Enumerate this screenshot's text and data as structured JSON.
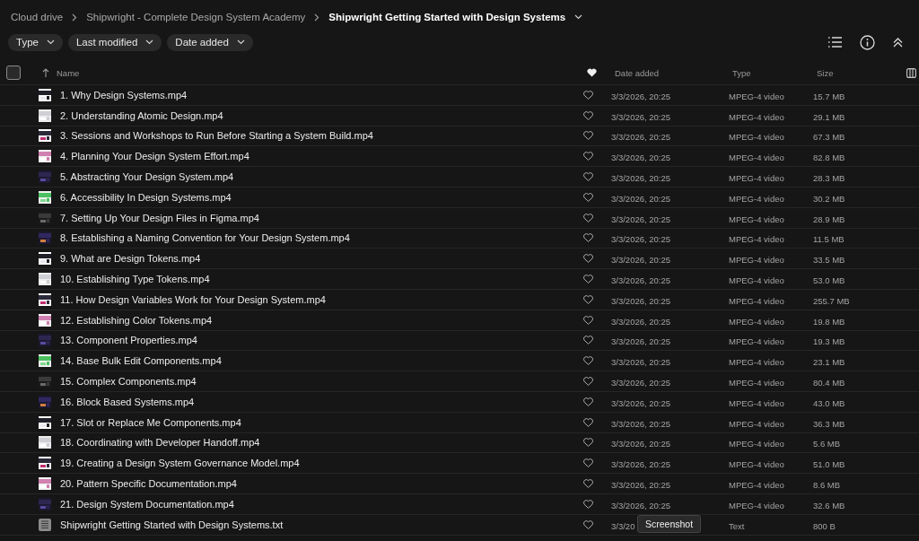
{
  "breadcrumbs": [
    {
      "label": "Cloud drive",
      "current": false
    },
    {
      "label": "Shipwright - Complete Design System Academy",
      "current": false
    },
    {
      "label": "Shipwright Getting Started with Design Systems",
      "current": true
    }
  ],
  "filters": [
    "Type",
    "Last modified",
    "Date added"
  ],
  "table": {
    "select_all": {
      "checked": false
    },
    "columns": [
      "Name",
      "Date added",
      "Type",
      "Size"
    ],
    "rows": [
      {
        "kind": "video",
        "name": "1. Why Design Systems.mp4",
        "favorite": false,
        "date": "3/3/2026, 20:25",
        "type": "MPEG-4 video",
        "size": "15.7 MB"
      },
      {
        "kind": "video",
        "name": "2. Understanding Atomic Design.mp4",
        "favorite": false,
        "date": "3/3/2026, 20:25",
        "type": "MPEG-4 video",
        "size": "29.1 MB"
      },
      {
        "kind": "video",
        "name": "3. Sessions and Workshops to Run Before Starting a System Build.mp4",
        "favorite": false,
        "date": "3/3/2026, 20:25",
        "type": "MPEG-4 video",
        "size": "67.3 MB"
      },
      {
        "kind": "video",
        "name": "4. Planning Your Design System Effort.mp4",
        "favorite": false,
        "date": "3/3/2026, 20:25",
        "type": "MPEG-4 video",
        "size": "82.8 MB"
      },
      {
        "kind": "video",
        "name": "5. Abstracting Your Design System.mp4",
        "favorite": false,
        "date": "3/3/2026, 20:25",
        "type": "MPEG-4 video",
        "size": "28.3 MB"
      },
      {
        "kind": "video",
        "name": "6. Accessibility In Design Systems.mp4",
        "favorite": false,
        "date": "3/3/2026, 20:25",
        "type": "MPEG-4 video",
        "size": "30.2 MB"
      },
      {
        "kind": "video",
        "name": "7. Setting Up Your Design Files in Figma.mp4",
        "favorite": false,
        "date": "3/3/2026, 20:25",
        "type": "MPEG-4 video",
        "size": "28.9 MB"
      },
      {
        "kind": "video",
        "name": "8. Establishing a Naming Convention for Your Design System.mp4",
        "favorite": false,
        "date": "3/3/2026, 20:25",
        "type": "MPEG-4 video",
        "size": "11.5 MB"
      },
      {
        "kind": "video",
        "name": "9. What are Design Tokens.mp4",
        "favorite": false,
        "date": "3/3/2026, 20:25",
        "type": "MPEG-4 video",
        "size": "33.5 MB"
      },
      {
        "kind": "video",
        "name": "10. Establishing Type Tokens.mp4",
        "favorite": false,
        "date": "3/3/2026, 20:25",
        "type": "MPEG-4 video",
        "size": "53.0 MB"
      },
      {
        "kind": "video",
        "name": "11. How Design Variables Work for Your Design System.mp4",
        "favorite": false,
        "date": "3/3/2026, 20:25",
        "type": "MPEG-4 video",
        "size": "255.7 MB"
      },
      {
        "kind": "video",
        "name": "12. Establishing Color Tokens.mp4",
        "favorite": false,
        "date": "3/3/2026, 20:25",
        "type": "MPEG-4 video",
        "size": "19.8 MB"
      },
      {
        "kind": "video",
        "name": "13. Component Properties.mp4",
        "favorite": false,
        "date": "3/3/2026, 20:25",
        "type": "MPEG-4 video",
        "size": "19.3 MB"
      },
      {
        "kind": "video",
        "name": "14. Base Bulk Edit Components.mp4",
        "favorite": false,
        "date": "3/3/2026, 20:25",
        "type": "MPEG-4 video",
        "size": "23.1 MB"
      },
      {
        "kind": "video",
        "name": "15. Complex Components.mp4",
        "favorite": false,
        "date": "3/3/2026, 20:25",
        "type": "MPEG-4 video",
        "size": "80.4 MB"
      },
      {
        "kind": "video",
        "name": "16. Block Based Systems.mp4",
        "favorite": false,
        "date": "3/3/2026, 20:25",
        "type": "MPEG-4 video",
        "size": "43.0 MB"
      },
      {
        "kind": "video",
        "name": "17. Slot or Replace Me Components.mp4",
        "favorite": false,
        "date": "3/3/2026, 20:25",
        "type": "MPEG-4 video",
        "size": "36.3 MB"
      },
      {
        "kind": "video",
        "name": "18. Coordinating with Developer Handoff.mp4",
        "favorite": false,
        "date": "3/3/2026, 20:25",
        "type": "MPEG-4 video",
        "size": "5.6 MB"
      },
      {
        "kind": "video",
        "name": "19. Creating a Design System Governance Model.mp4",
        "favorite": false,
        "date": "3/3/2026, 20:25",
        "type": "MPEG-4 video",
        "size": "51.0 MB"
      },
      {
        "kind": "video",
        "name": "20. Pattern Specific Documentation.mp4",
        "favorite": false,
        "date": "3/3/2026, 20:25",
        "type": "MPEG-4 video",
        "size": "8.6 MB"
      },
      {
        "kind": "video",
        "name": "21. Design System Documentation.mp4",
        "favorite": false,
        "date": "3/3/2026, 20:25",
        "type": "MPEG-4 video",
        "size": "32.6 MB"
      },
      {
        "kind": "text",
        "name": "Shipwright Getting Started with Design Systems.txt",
        "favorite": false,
        "date": "3/3/20",
        "type": "Text",
        "size": "800 B"
      }
    ]
  },
  "tooltip": {
    "label": "Screenshot"
  }
}
